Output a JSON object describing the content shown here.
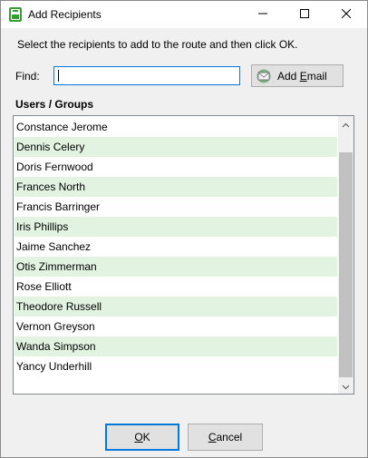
{
  "window": {
    "title": "Add Recipients",
    "minimize_glyph": "—",
    "maximize_glyph": "☐",
    "close_glyph": "✕"
  },
  "instructions": "Select the recipients to add to the route and then click OK.",
  "find": {
    "label": "Find:",
    "value": "",
    "add_email_prefix": "Add ",
    "add_email_mnemonic": "E",
    "add_email_suffix": "mail"
  },
  "users_groups": {
    "label": "Users / Groups",
    "items": [
      "Constance Jerome",
      "Dennis Celery",
      "Doris Fernwood",
      "Frances North",
      "Francis Barringer",
      "Iris Phillips",
      "Jaime Sanchez",
      "Otis Zimmerman",
      "Rose Elliott",
      "Theodore Russell",
      "Vernon Greyson",
      "Wanda Simpson",
      "Yancy Underhill"
    ]
  },
  "buttons": {
    "ok_mnemonic": "O",
    "ok_rest": "K",
    "cancel_mnemonic": "C",
    "cancel_rest": "ancel"
  },
  "colors": {
    "alt_row": "#e2f3e2",
    "focus_accent": "#0078d7",
    "icon_green": "#3a9a3a"
  },
  "icons": {
    "app": "routing-slip-icon",
    "add_email": "mail-envelope-icon"
  }
}
